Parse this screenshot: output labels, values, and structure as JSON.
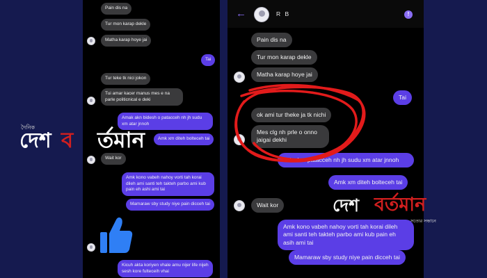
{
  "header": {
    "name": "R B"
  },
  "left_messages": {
    "m1": "Pain dis na",
    "m2": "Tur mon karap dekle",
    "m3": "Matha karap hoye jai",
    "m4": "Tai",
    "m5": "Tur teke tk nici jokon",
    "m6": "Tui amar kacer manus mes e na parle politicnical e deki",
    "m7": "Amak akn bidesh o patacceh nh jh sudu xm atar jnnoh",
    "m8": "Amk xm diteh bolteceh tai",
    "m9": "Wait kor",
    "m10": "Amk kono vabeh nahoy vorti tah korai dileh ami santi teh takteh parbo ami kub pain eh ashi ami tai",
    "m11": "Mamaraw sby study niye pain dicceh tai",
    "m12": "Kicuh akta koriyen vhale amu nijer life nijeh sesh kore fulteceih vhai"
  },
  "right_messages": {
    "r1": "Pain dis na",
    "r2": "Tur mon karap dekle",
    "r3": "Matha karap hoye jai",
    "r4": "Tai",
    "r5": "ok ami tur theke ja tk nichi",
    "r6": "Mes clg nh prle o onno jaigai dekhi",
    "r7": "bidesh o patacceh nh jh sudu xm atar jnnoh",
    "r8": "Amk xm diteh bolteceh tai",
    "r9": "Wait kor",
    "r10": "Amk kono vabeh nahoy vorti tah korai dileh ami santi teh takteh parbo ami kub pain eh asih ami tai",
    "r11": "Mamaraw sby study niye pain dicceh tai"
  },
  "watermark": {
    "left_small": "দৈনিক",
    "left_part1": "দেশ",
    "left_part2": "ব",
    "left_part3": "র্তমান",
    "right_part1": "দেশ",
    "right_part2": "বর্তমান",
    "right_small": "সত্যের সন্ধানে"
  },
  "icons": {
    "back": "back-arrow-icon",
    "info": "info-icon",
    "like": "thumbs-up-icon"
  },
  "colors": {
    "outgoing_bubble": "#5b3ee6",
    "incoming_bubble": "#3a3a3c",
    "background": "#151a4f",
    "annotation": "#e21b1b"
  }
}
